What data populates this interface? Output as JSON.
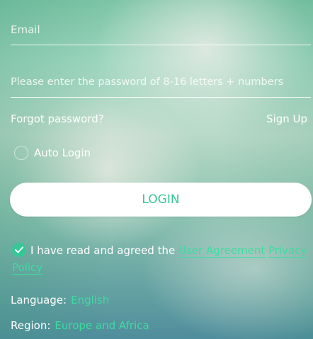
{
  "form": {
    "email_placeholder": "Email",
    "password_placeholder": "Please enter the password of 8-16 letters + numbers",
    "forgot_label": "Forgot password?",
    "signup_label": "Sign Up",
    "auto_login_label": "Auto Login",
    "login_label": "LOGIN"
  },
  "agreement": {
    "checked": true,
    "text": "I have read and agreed the",
    "user_agreement": "User Agreement",
    "privacy_policy": "Privacy Policy"
  },
  "settings": {
    "language_label": "Language:",
    "language_value": "English",
    "region_label": "Region:",
    "region_value": "Europe and Africa"
  },
  "colors": {
    "accent": "#36c796",
    "link": "#3ddca0",
    "text": "#ffffff"
  },
  "icons": {
    "agree_check": "check-icon",
    "auto_login_radio": "radio-circle-icon"
  }
}
